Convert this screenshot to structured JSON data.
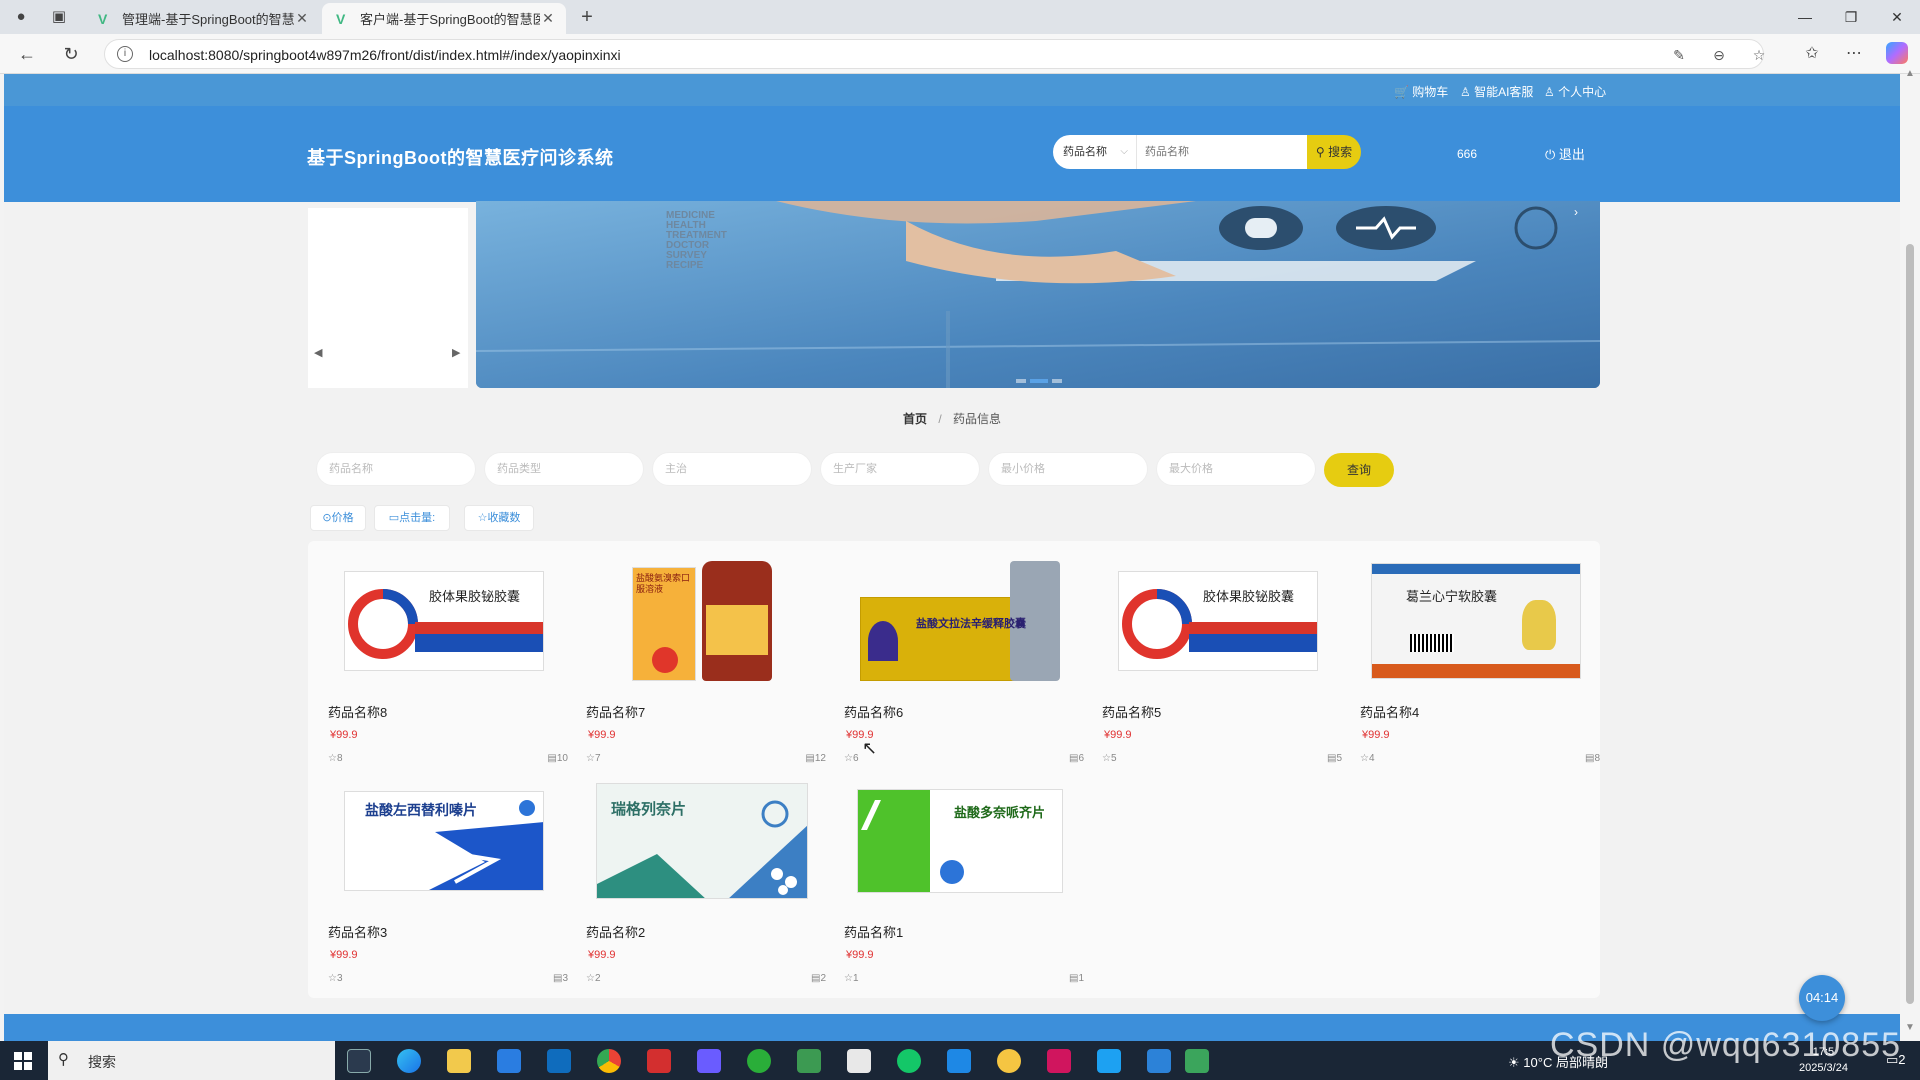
{
  "browser": {
    "tabs": [
      {
        "title": "管理端-基于SpringBoot的智慧医"
      },
      {
        "title": "客户端-基于SpringBoot的智慧医"
      }
    ],
    "url": "localhost:8080/springboot4w897m26/front/dist/index.html#/index/yaopinxinxi"
  },
  "topbar": {
    "cart": "购物车",
    "ai_service": "智能AI客服",
    "profile": "个人中心"
  },
  "header": {
    "title": "基于SpringBoot的智慧医疗问诊系统",
    "search_select": "药品名称",
    "search_placeholder": "药品名称",
    "search_button": "搜索",
    "username": "666",
    "logout": "退出"
  },
  "carousel": {
    "banner_words": [
      "MEDICINE",
      "HEALTH",
      "TREATMENT",
      "DOCTOR",
      "SURVEY",
      "RECIPE"
    ]
  },
  "breadcrumb": {
    "home": "首页",
    "separator": "/",
    "current": "药品信息"
  },
  "filters": [
    {
      "placeholder": "药品名称"
    },
    {
      "placeholder": "药品类型"
    },
    {
      "placeholder": "主治"
    },
    {
      "placeholder": "生产厂家"
    },
    {
      "placeholder": "最小价格"
    },
    {
      "placeholder": "最大价格"
    }
  ],
  "query_button": "查询",
  "sort": {
    "price": "价格",
    "clicks": "点击量:",
    "favorites": "收藏数"
  },
  "products": [
    {
      "name": "药品名称8",
      "price": "¥99.9",
      "likes": "8",
      "views": "10",
      "box_text": "胶体果胶铋胶囊",
      "color": "#1a4fb5"
    },
    {
      "name": "药品名称7",
      "price": "¥99.9",
      "likes": "7",
      "views": "12",
      "box_text": "盐酸氨溴索口服溶液",
      "color": "#f0a030"
    },
    {
      "name": "药品名称6",
      "price": "¥99.9",
      "likes": "6",
      "views": "6",
      "box_text": "盐酸文拉法辛缓释胶囊",
      "color": "#c9a000"
    },
    {
      "name": "药品名称5",
      "price": "¥99.9",
      "likes": "5",
      "views": "5",
      "box_text": "胶体果胶铋胶囊",
      "color": "#1a4fb5"
    },
    {
      "name": "药品名称4",
      "price": "¥99.9",
      "likes": "4",
      "views": "8",
      "box_text": "葛兰心宁软胶囊",
      "color": "#d85a1c"
    },
    {
      "name": "药品名称3",
      "price": "¥99.9",
      "likes": "3",
      "views": "3",
      "box_text": "盐酸左西替利嗪片",
      "color": "#1c56c9"
    },
    {
      "name": "药品名称2",
      "price": "¥99.9",
      "likes": "2",
      "views": "2",
      "box_text": "瑞格列奈片",
      "color": "#2d8f80"
    },
    {
      "name": "药品名称1",
      "price": "¥99.9",
      "likes": "1",
      "views": "1",
      "box_text": "盐酸多奈哌齐片",
      "color": "#4fc22b"
    }
  ],
  "timer": "04:14",
  "taskbar": {
    "search": "搜索",
    "weather": "10°C 局部晴朗",
    "time": "17:5",
    "date": "2025/3/24",
    "notification_count": "2"
  },
  "watermark": "CSDN @wqq6310855"
}
